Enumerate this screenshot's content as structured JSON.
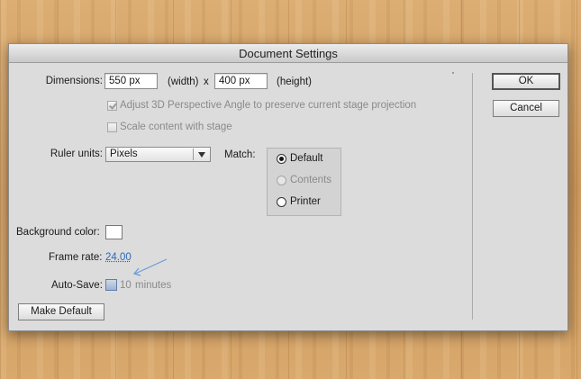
{
  "dialog": {
    "title": "Document Settings",
    "dimensions": {
      "label": "Dimensions:",
      "width_value": "550 px",
      "width_label": "(width)",
      "separator": "x",
      "height_value": "400 px",
      "height_label": "(height)"
    },
    "adjust_3d": {
      "label": "Adjust 3D Perspective Angle to preserve current stage projection",
      "checked": true,
      "enabled": false
    },
    "scale_content": {
      "label": "Scale content with stage",
      "checked": false,
      "enabled": false
    },
    "ruler_units": {
      "label": "Ruler units:",
      "value": "Pixels"
    },
    "match": {
      "label": "Match:",
      "options": [
        {
          "label": "Default",
          "selected": true,
          "enabled": true
        },
        {
          "label": "Contents",
          "selected": false,
          "enabled": false
        },
        {
          "label": "Printer",
          "selected": false,
          "enabled": true
        }
      ]
    },
    "background_color": {
      "label": "Background color:",
      "value": "#ffffff"
    },
    "frame_rate": {
      "label": "Frame rate:",
      "value": "24.00"
    },
    "auto_save": {
      "label": "Auto-Save:",
      "value": "10",
      "unit": "minutes",
      "checked": false
    },
    "buttons": {
      "make_default": "Make Default",
      "ok": "OK",
      "cancel": "Cancel"
    }
  }
}
